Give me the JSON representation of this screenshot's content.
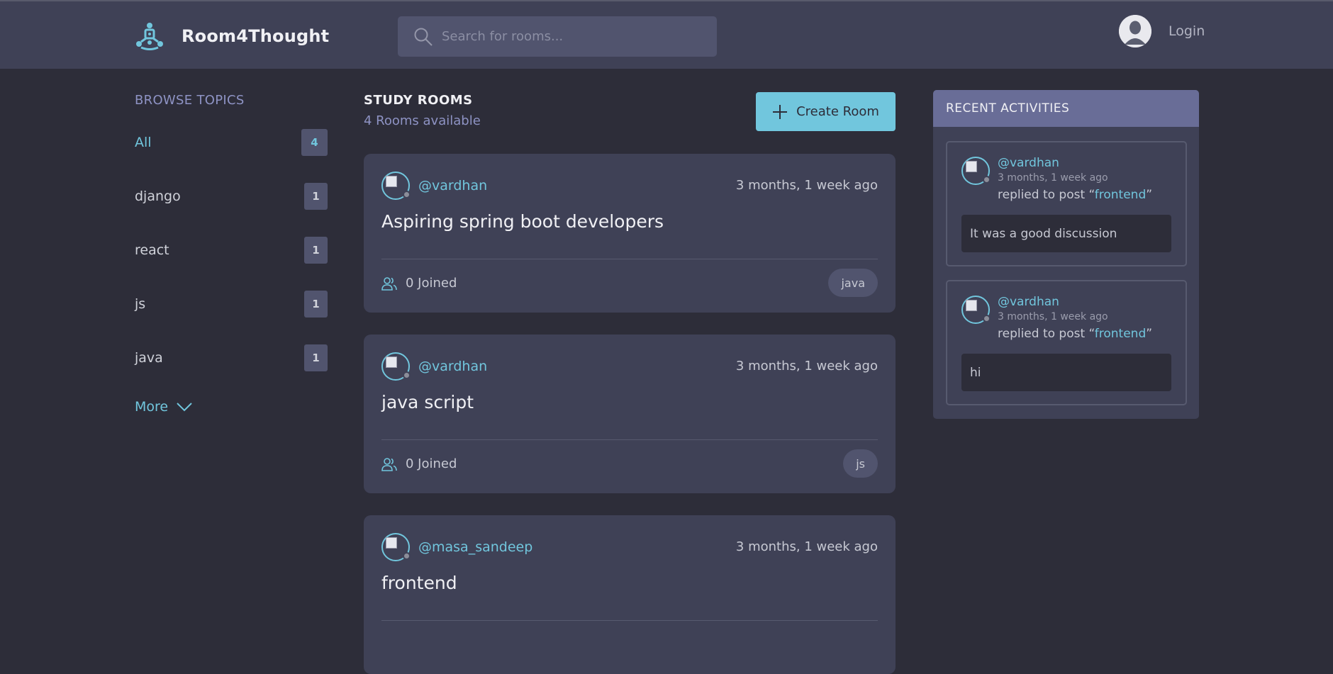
{
  "header": {
    "brand": "Room4Thought",
    "search_placeholder": "Search for rooms...",
    "login_label": "Login"
  },
  "sidebar": {
    "title": "BROWSE TOPICS",
    "topics": [
      {
        "label": "All",
        "count": "4"
      },
      {
        "label": "django",
        "count": "1"
      },
      {
        "label": "react",
        "count": "1"
      },
      {
        "label": "js",
        "count": "1"
      },
      {
        "label": "java",
        "count": "1"
      }
    ],
    "more_label": "More"
  },
  "rooms": {
    "title": "STUDY ROOMS",
    "subtitle": "4 Rooms available",
    "create_label": "Create Room",
    "items": [
      {
        "host": "@vardhan",
        "time": "3 months, 1 week ago",
        "title": "Aspiring spring boot developers",
        "joined": "0 Joined",
        "tag": "java"
      },
      {
        "host": "@vardhan",
        "time": "3 months, 1 week ago",
        "title": "java script",
        "joined": "0 Joined",
        "tag": "js"
      },
      {
        "host": "@masa_sandeep",
        "time": "3 months, 1 week ago",
        "title": "frontend",
        "joined": "",
        "tag": ""
      }
    ]
  },
  "activities": {
    "title": "RECENT ACTIVITIES",
    "items": [
      {
        "user": "@vardhan",
        "time": "3 months, 1 week ago",
        "action": "replied to post",
        "post": "frontend",
        "message": "It was a good discussion"
      },
      {
        "user": "@vardhan",
        "time": "3 months, 1 week ago",
        "action": "replied to post",
        "post": "frontend",
        "message": "hi"
      }
    ]
  },
  "colors": {
    "accent": "#71c6dd",
    "background": "#2d2d39",
    "card": "#3f4156",
    "muted": "#8e93c4"
  }
}
